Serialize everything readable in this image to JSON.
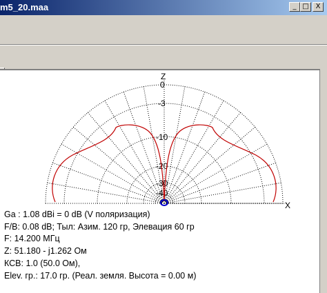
{
  "window": {
    "title": "m5_20.maa",
    "buttons": {
      "minimize": "_",
      "maximize": "□",
      "close": "X"
    }
  },
  "plot": {
    "axis_z": "Z",
    "axis_x": "X",
    "ring_labels": [
      "0",
      "-3",
      "-10",
      "-20",
      "-30",
      "-40"
    ],
    "pattern_color": "#c00000",
    "grid_color": "#000000"
  },
  "info": {
    "ga": "Ga : 1.08 dBi = 0 dB  (V поляризация)",
    "fb": "F/B: 0.08 dB; Тыл: Азим. 120 гр, Элевация 60 гр",
    "freq": "F: 14.200 МГц",
    "z": "Z: 51.180 - j1.262 Ом",
    "swr": "КСВ: 1.0 (50.0 Ом),",
    "elev": "Elev. гр.: 17.0 гр. (Реал. земля. Высота = 0.00 м)"
  }
}
